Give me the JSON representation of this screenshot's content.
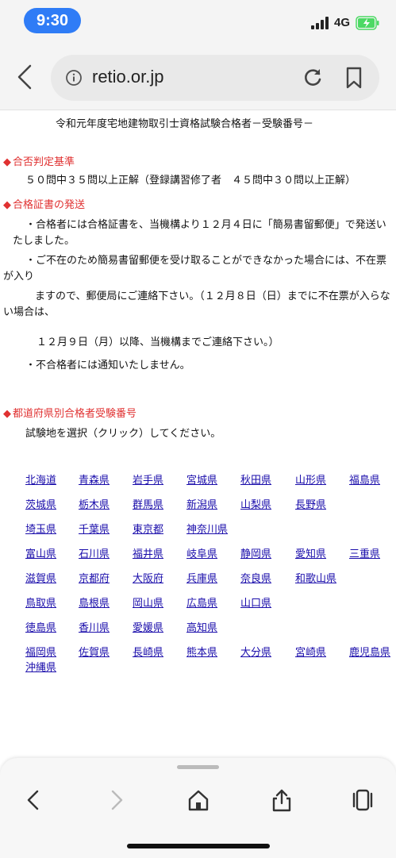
{
  "status_bar": {
    "time": "9:30",
    "network": "4G"
  },
  "browser": {
    "url": "retio.or.jp"
  },
  "page": {
    "title": "令和元年度宅地建物取引士資格試験合格者－受験番号－",
    "sections": {
      "criteria": {
        "heading": "合否判定基準",
        "text": "５０問中３５問以上正解（登録講習修了者　４５問中３０問以上正解）"
      },
      "certificate": {
        "heading": "合格証書の発送",
        "line1": "・合格者には合格証書を、当機構より１２月４日に「簡易書留郵便」で発送いたしました。",
        "line2": "・ご不在のため簡易書留郵便を受け取ることができなかった場合には、不在票が入り",
        "line3": "ますので、郵便局にご連絡下さい。（１２月８日（日）までに不在票が入らない場合は、",
        "line4": "１２月９日（月）以降、当機構までご連絡下さい。）",
        "line5": "・不合格者には通知いたしません。"
      },
      "numbers": {
        "heading": "都道府県別合格者受験番号",
        "instruction": "試験地を選択（クリック）してください。"
      }
    },
    "prefectures": [
      [
        "北海道",
        "青森県",
        "岩手県",
        "宮城県",
        "秋田県",
        "山形県",
        "福島県"
      ],
      [
        "茨城県",
        "栃木県",
        "群馬県",
        "新潟県",
        "山梨県",
        "長野県"
      ],
      [
        "埼玉県",
        "千葉県",
        "東京都",
        "神奈川県"
      ],
      [
        "富山県",
        "石川県",
        "福井県",
        "岐阜県",
        "静岡県",
        "愛知県",
        "三重県"
      ],
      [
        "滋賀県",
        "京都府",
        "大阪府",
        "兵庫県",
        "奈良県",
        "和歌山県"
      ],
      [
        "鳥取県",
        "島根県",
        "岡山県",
        "広島県",
        "山口県"
      ],
      [
        "徳島県",
        "香川県",
        "愛媛県",
        "高知県"
      ],
      [
        "福岡県",
        "佐賀県",
        "長崎県",
        "熊本県",
        "大分県",
        "宮崎県",
        "鹿児島県"
      ],
      [
        "沖縄県"
      ]
    ]
  },
  "colors": {
    "link": "#1a0dab",
    "heading": "#e03131",
    "time_pill": "#2f7cf6",
    "battery": "#4cd964"
  }
}
